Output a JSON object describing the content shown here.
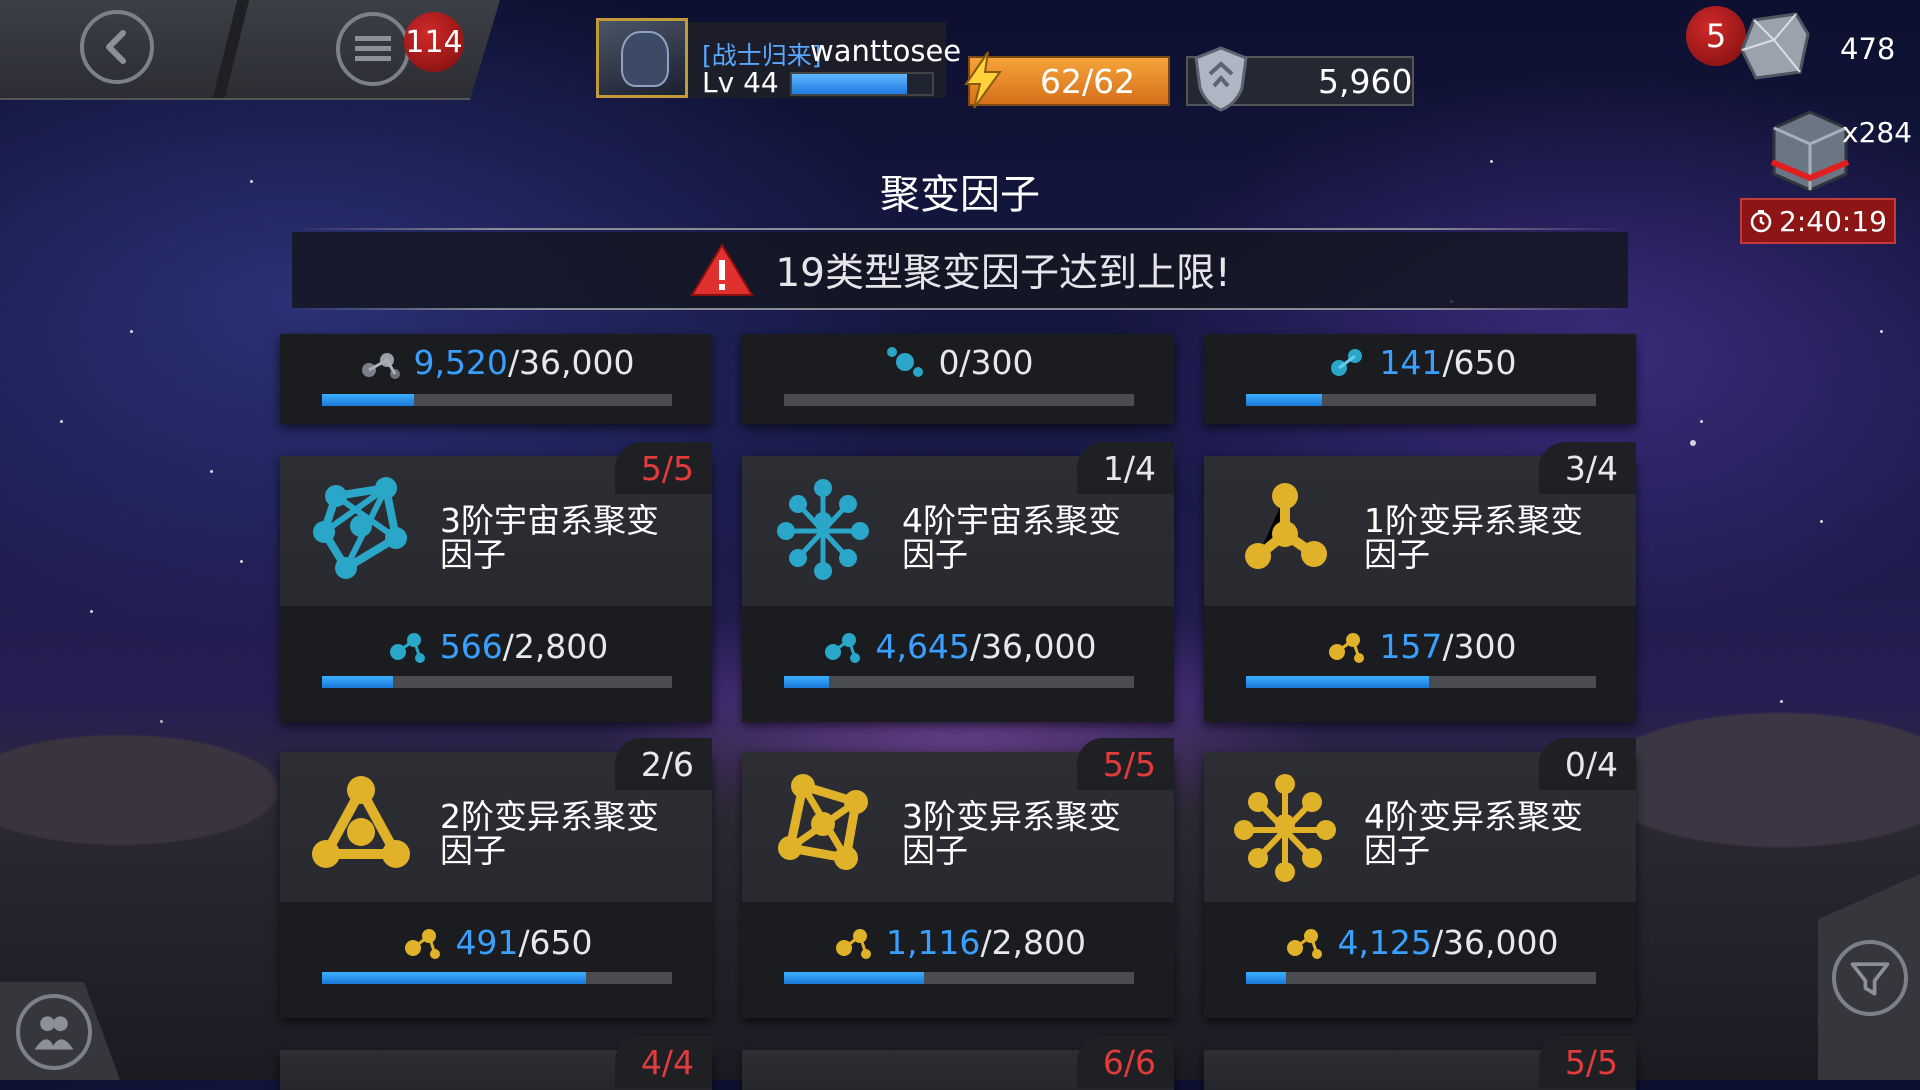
{
  "topbar": {
    "menu_badge": "114",
    "alliance_tag": "[战士归来]",
    "player_name": "wanttosee",
    "level": "Lv 44",
    "xp_progress": 0.82,
    "energy": "62/62",
    "gold": "5,960",
    "crystal_badge": "5",
    "crystal_count": "478",
    "chest_count": "x284",
    "chest_timer": "2:40:19"
  },
  "page": {
    "title": "聚变因子",
    "warning": "19类型聚变因子达到上限!"
  },
  "colors": {
    "progress_blue": "#1f8ef0",
    "current_value_blue": "#3aa0ff",
    "full_red": "#e23b3b",
    "cosmic_teal": "#2aa6c8",
    "mutant_gold": "#e0b22a"
  },
  "cards_top": [
    {
      "current": "9,520",
      "max": "/36,000",
      "progress": 0.264,
      "icon": "gray-catalyst-icon"
    },
    {
      "current": "",
      "max": "0/300",
      "progress": 0.0,
      "icon": "teal-catalyst-icon"
    },
    {
      "current": "141",
      "max": "/650",
      "progress": 0.217,
      "icon": "teal-catalyst-icon"
    }
  ],
  "cards": [
    {
      "name": "3阶宇宙系聚变因子",
      "count": "5/5",
      "full": true,
      "current": "566",
      "max": "/2,800",
      "progress": 0.202,
      "color": "#2aa6c8",
      "icon": "cosmic-tier3-catalyst-icon"
    },
    {
      "name": "4阶宇宙系聚变因子",
      "count": "1/4",
      "full": false,
      "current": "4,645",
      "max": "/36,000",
      "progress": 0.129,
      "color": "#2aa6c8",
      "icon": "cosmic-tier4-catalyst-icon"
    },
    {
      "name": "1阶变异系聚变因子",
      "count": "3/4",
      "full": false,
      "current": "157",
      "max": "/300",
      "progress": 0.523,
      "color": "#e0b22a",
      "icon": "mutant-tier1-catalyst-icon"
    },
    {
      "name": "2阶变异系聚变因子",
      "count": "2/6",
      "full": false,
      "current": "491",
      "max": "/650",
      "progress": 0.755,
      "color": "#e0b22a",
      "icon": "mutant-tier2-catalyst-icon"
    },
    {
      "name": "3阶变异系聚变因子",
      "count": "5/5",
      "full": true,
      "current": "1,116",
      "max": "/2,800",
      "progress": 0.399,
      "color": "#e0b22a",
      "icon": "mutant-tier3-catalyst-icon"
    },
    {
      "name": "4阶变异系聚变因子",
      "count": "0/4",
      "full": false,
      "current": "4,125",
      "max": "/36,000",
      "progress": 0.115,
      "color": "#e0b22a",
      "icon": "mutant-tier4-catalyst-icon"
    }
  ],
  "cards_bottom": [
    {
      "count": "4/4"
    },
    {
      "count": "6/6"
    },
    {
      "count": "5/5"
    }
  ]
}
